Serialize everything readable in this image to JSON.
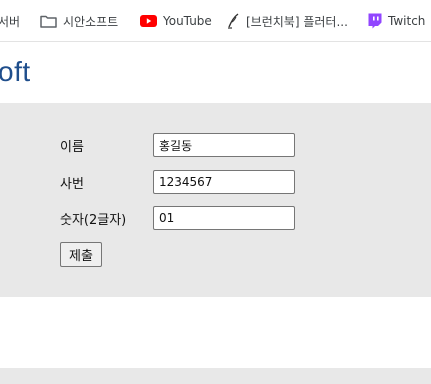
{
  "bookmarks": [
    {
      "label": "서버",
      "icon": "none"
    },
    {
      "label": "시안소프트",
      "icon": "folder-icon"
    },
    {
      "label": "YouTube",
      "icon": "youtube-icon"
    },
    {
      "label": "[브런치북] 플러터...",
      "icon": "brunch-icon"
    },
    {
      "label": "Twitch",
      "icon": "twitch-icon"
    }
  ],
  "brand": {
    "text": "oft",
    "color": "#1f4e8c"
  },
  "form": {
    "fields": [
      {
        "label": "이름",
        "value": "홍길동"
      },
      {
        "label": "사번",
        "value": "1234567"
      },
      {
        "label": "숫자(2글자)",
        "value": "01"
      }
    ],
    "submit_label": "제출"
  },
  "colors": {
    "panel": "#e8e8e8",
    "youtube": "#ff0000",
    "twitch": "#9146ff"
  }
}
